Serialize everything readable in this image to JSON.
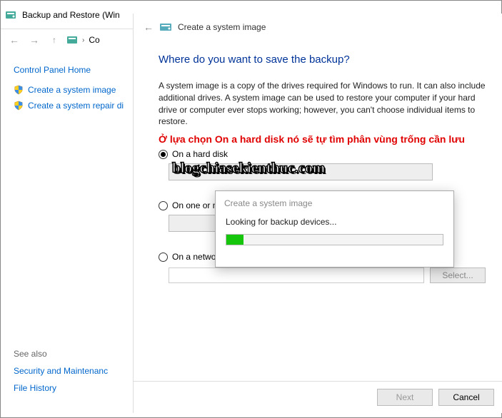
{
  "cp": {
    "title": "Backup and Restore (Win",
    "breadcrumb_item": "Co",
    "home": "Control Panel Home",
    "links": {
      "create_image": "Create a system image",
      "create_disc": "Create a system repair di"
    },
    "see_also": {
      "header": "See also",
      "security": "Security and Maintenanc",
      "file_history": "File History"
    }
  },
  "wizard": {
    "title": "Create a system image",
    "heading": "Where do you want to save the backup?",
    "description": "A system image is a copy of the drives required for Windows to run. It can also include additional drives. A system image can be used to restore your computer if your hard drive or computer ever stops working; however, you can't choose individual items to restore.",
    "red_note": "Ở lựa chọn On a hard disk nó sẽ tự tìm phân vùng trống cần lưu",
    "options": {
      "hard_disk": "On a hard disk",
      "dvd": "On one or more D",
      "network": "On a network location"
    },
    "select_btn": "Select...",
    "next_btn": "Next",
    "cancel_btn": "Cancel"
  },
  "progress": {
    "title": "Create a system image",
    "message": "Looking for backup devices..."
  },
  "watermark": "blogchiasekienthuc.com"
}
